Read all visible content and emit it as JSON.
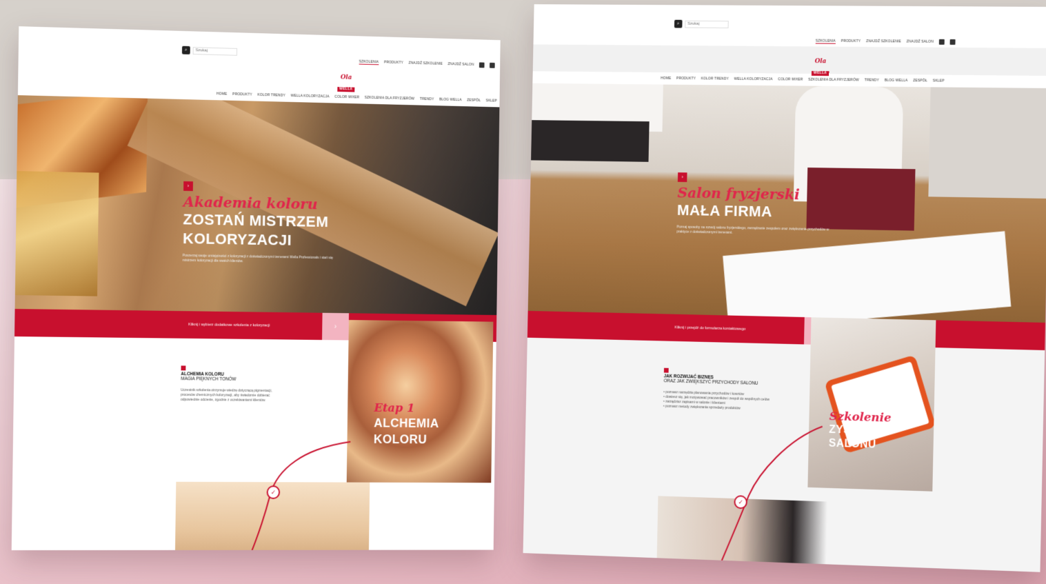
{
  "colors": {
    "brand": "#c8102e",
    "accent_pink": "#f3b4c1",
    "script_red": "#e0254b"
  },
  "left": {
    "search": {
      "placeholder": "Szukaj"
    },
    "utility": [
      "Szkolenia",
      "Produkty",
      "Znajdź Szkolenie",
      "Znajdź Salon"
    ],
    "logo": {
      "script": "Ola",
      "word": "WELLA"
    },
    "nav": [
      "Home",
      "Produkty",
      "Kolor Trendy",
      "Wella Koloryzacja",
      "Color Mixer",
      "Szkolenia dla fryzjerów",
      "Trendy",
      "Blog Wella",
      "Zespół",
      "Sklep"
    ],
    "hero": {
      "marker": "›",
      "script": "Akademia koloru",
      "title_line1": "ZOSTAŃ MISTRZEM",
      "title_line2": "KOLORYZACJI",
      "body": "Poszerzaj swoje umiejętności z koloryzacji z doświadczonymi trenerami Wella Professionals i stań się mistrzem koloryzacji dla swoich klientów."
    },
    "ribbon": {
      "text": "Kliknij i wybierz dodatkowe szkolenia z koloryzacji",
      "button_icon": "›"
    },
    "block": {
      "h1": "ALCHEMIA KOLORU",
      "h2": "MAGIA PIĘKNYCH TONÓW",
      "body": "Uczestnik szkolenia otrzymuje wiedzę dotyczącą pigmentacji, procesów chemicznych koloryzacji, aby świadomie dobierać odpowiednie odcienie, zgodnie z oczekiwaniami klientów."
    },
    "feature": {
      "script": "Etap 1",
      "line1": "ALCHEMIA",
      "line2": "KOLORU"
    },
    "step_icon": "✓"
  },
  "right": {
    "search": {
      "placeholder": "Szukaj"
    },
    "utility": [
      "Szkolenia",
      "Produkty",
      "Znajdź Szkolenie",
      "Znajdź Salon"
    ],
    "logo": {
      "script": "Ola",
      "word": "WELLA"
    },
    "nav": [
      "Home",
      "Produkty",
      "Kolor Trendy",
      "Wella Koloryzacja",
      "Color Mixer",
      "Szkolenia dla fryzjerów",
      "Trendy",
      "Blog Wella",
      "Zespół",
      "Sklep"
    ],
    "hero": {
      "marker": "›",
      "script": "Salon fryzjerski",
      "title_line1": "MAŁA FIRMA",
      "body": "Poznaj sposoby na rozwój salonu fryzjerskiego, zarządzanie zespołem oraz zwiększanie przychodów w praktyce z doświadczonymi trenerami."
    },
    "ribbon": {
      "text": "Kliknij i przejdź do formularza kontaktowego",
      "button_icon": "›"
    },
    "block": {
      "h1": "JAK ROZWIJAĆ BIZNES",
      "h2": "ORAZ JAK ZWIĘKSZYĆ PRZYCHODY SALONU",
      "bullets": [
        "• poznasz narzędzia planowania przychodów i kosztów",
        "• dowiesz się, jak motywować pracowników i zespół do wspólnych celów",
        "• zarządzisz zapisami w salonie i klientami",
        "• poznasz metody zwiększania sprzedaży produktów"
      ]
    },
    "feature": {
      "script": "Szkolenie",
      "line1": "ZYSK",
      "line2": "SALONU"
    },
    "step_icon": "✓"
  }
}
